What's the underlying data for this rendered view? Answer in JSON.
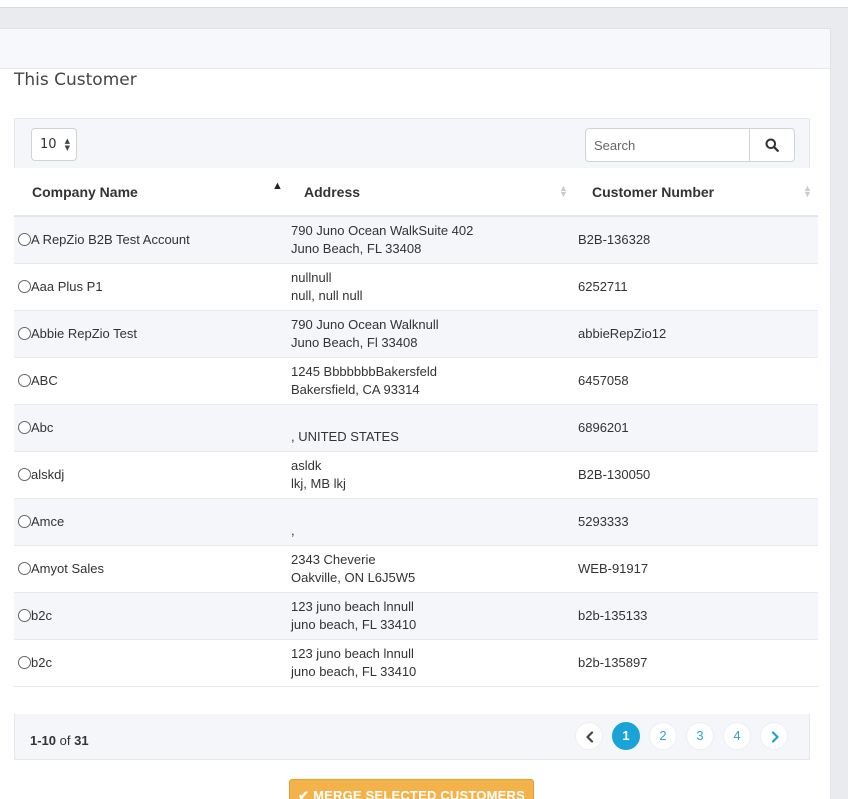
{
  "section": {
    "title": "This Customer"
  },
  "toolbar": {
    "page_size": "10",
    "search_placeholder": "Search"
  },
  "table": {
    "columns": [
      "Company Name",
      "Address",
      "Customer Number"
    ],
    "rows": [
      {
        "company": "A RepZio B2B Test Account",
        "addr1": "790 Juno Ocean WalkSuite 402",
        "addr2": "Juno Beach, FL 33408",
        "number": "B2B-136328"
      },
      {
        "company": "Aaa Plus P1",
        "addr1": "nullnull",
        "addr2": "null, null null",
        "number": "6252711"
      },
      {
        "company": "Abbie RepZio Test",
        "addr1": "790 Juno Ocean Walknull",
        "addr2": "Juno Beach, Fl 33408",
        "number": "abbieRepZio12"
      },
      {
        "company": "ABC",
        "addr1": "1245 BbbbbbbBakersfeld",
        "addr2": "Bakersfield, CA 93314",
        "number": "6457058"
      },
      {
        "company": "Abc",
        "addr1": "",
        "addr2": ", UNITED STATES",
        "number": "6896201"
      },
      {
        "company": "alskdj",
        "addr1": "asldk",
        "addr2": "lkj, MB lkj",
        "number": "B2B-130050"
      },
      {
        "company": "Amce",
        "addr1": "",
        "addr2": ",",
        "number": "5293333"
      },
      {
        "company": "Amyot Sales",
        "addr1": "2343 Cheverie",
        "addr2": "Oakville, ON L6J5W5",
        "number": "WEB-91917"
      },
      {
        "company": "b2c",
        "addr1": "123 juno beach lnnull",
        "addr2": "juno beach, FL 33410",
        "number": "b2b-135133"
      },
      {
        "company": "b2c",
        "addr1": "123 juno beach lnnull",
        "addr2": "juno beach, FL 33410",
        "number": "b2b-135897"
      }
    ]
  },
  "footer": {
    "range": "1-10",
    "of_label": "of",
    "total": "31",
    "pages": [
      "1",
      "2",
      "3",
      "4"
    ],
    "current_page": "1"
  },
  "actions": {
    "merge_label": "MERGE SELECTED CUSTOMERS"
  },
  "colors": {
    "accent": "#1aa3d6",
    "merge_button": "#f3b24a",
    "link": "#2ea2cc"
  }
}
